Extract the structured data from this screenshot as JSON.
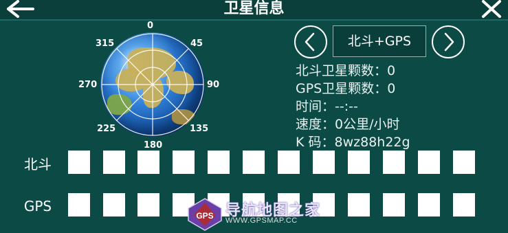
{
  "header": {
    "title": "卫星信息"
  },
  "skyplot": {
    "degrees": {
      "n": "0",
      "ne": "45",
      "e": "90",
      "se": "135",
      "s": "180",
      "sw": "225",
      "w": "270",
      "nw": "315"
    }
  },
  "panel": {
    "mode": "北斗+GPS",
    "beidou_count_label": "北斗卫星颗数：",
    "beidou_count": "0",
    "gps_count_label": "GPS卫星颗数：",
    "gps_count": "0",
    "time_label": "时间：",
    "time_value": "--:--",
    "speed_label": "速度：",
    "speed_value": "0公里/小时",
    "kcode_label": "K 码：",
    "kcode_value": "8wz88h22g"
  },
  "signals": {
    "beidou_label": "北斗",
    "gps_label": "GPS"
  },
  "watermark": {
    "name": "导航地图之家",
    "url": "WWW.GPSMAP.CC",
    "logo_text": "GPS"
  },
  "colors": {
    "background": "#0c4a45",
    "header": "#0b3f3b",
    "box": "#ffffff",
    "text": "#ffffff"
  }
}
